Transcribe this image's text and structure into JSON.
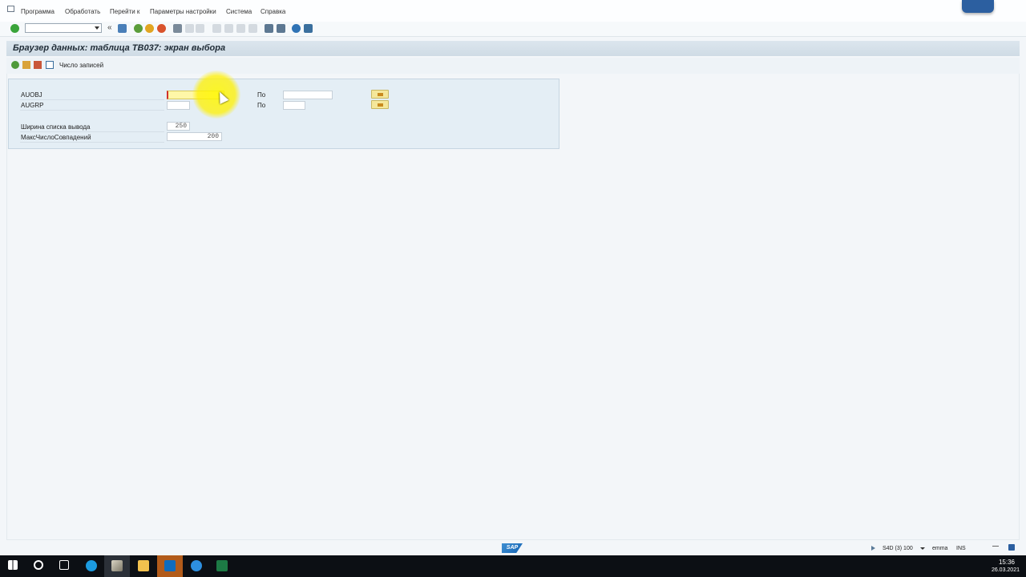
{
  "menu": {
    "items": [
      "Программа",
      "Обработать",
      "Перейти к",
      "Параметры настройки",
      "Система",
      "Справка"
    ]
  },
  "title": "Браузер данных: таблица TB037: экран выбора",
  "app_toolbar": {
    "records_label": "Число записей"
  },
  "selection": {
    "rows": [
      {
        "label": "AUOBJ",
        "from_value": "",
        "to_label": "По",
        "to_value": ""
      },
      {
        "label": "AUGRP",
        "from_value": "",
        "to_label": "По",
        "to_value": ""
      }
    ],
    "params": [
      {
        "label": "Ширина списка вывода",
        "value": "250"
      },
      {
        "label": "МаксЧислоСовпадений",
        "value": "200"
      }
    ]
  },
  "status": {
    "system": "S4D (3) 100",
    "user": "emma",
    "mode": "INS",
    "logo": "SAP"
  },
  "taskbar": {
    "time": "15:36",
    "date": "26.03.2021",
    "apps": [
      "windows-start-icon",
      "search-icon",
      "task-view-icon",
      "skype-icon",
      "sap-logon-icon",
      "file-explorer-icon",
      "outlook-icon",
      "edge-icon",
      "excel-icon"
    ]
  },
  "colors": {
    "input_active": "#fff7a8",
    "title_bar": "#cfdbe5",
    "panel": "#e4eef5",
    "taskbar": "#0c0f14"
  }
}
